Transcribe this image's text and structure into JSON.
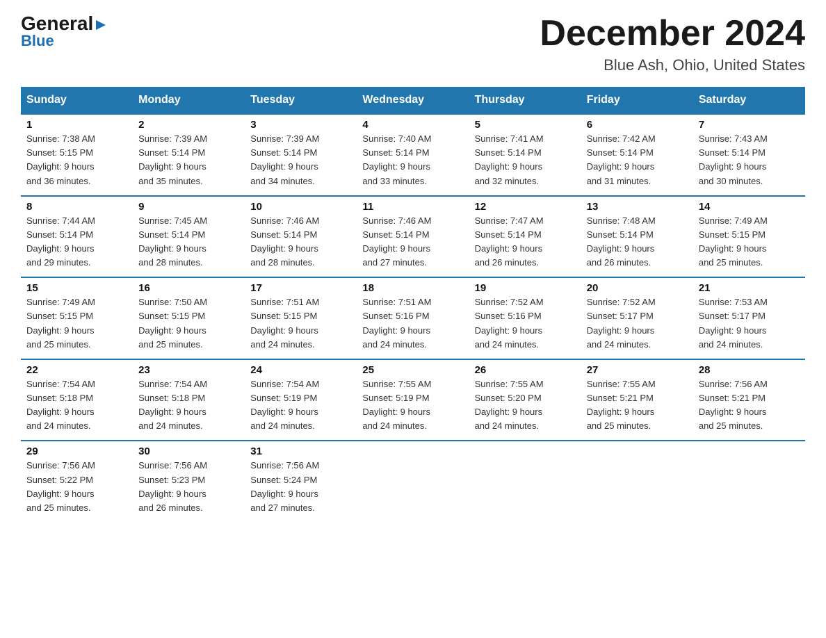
{
  "logo": {
    "general": "General",
    "arrow": "▶",
    "blue": "Blue"
  },
  "title": "December 2024",
  "location": "Blue Ash, Ohio, United States",
  "days_of_week": [
    "Sunday",
    "Monday",
    "Tuesday",
    "Wednesday",
    "Thursday",
    "Friday",
    "Saturday"
  ],
  "weeks": [
    [
      {
        "day": "1",
        "sunrise": "7:38 AM",
        "sunset": "5:15 PM",
        "daylight": "9 hours and 36 minutes."
      },
      {
        "day": "2",
        "sunrise": "7:39 AM",
        "sunset": "5:14 PM",
        "daylight": "9 hours and 35 minutes."
      },
      {
        "day": "3",
        "sunrise": "7:39 AM",
        "sunset": "5:14 PM",
        "daylight": "9 hours and 34 minutes."
      },
      {
        "day": "4",
        "sunrise": "7:40 AM",
        "sunset": "5:14 PM",
        "daylight": "9 hours and 33 minutes."
      },
      {
        "day": "5",
        "sunrise": "7:41 AM",
        "sunset": "5:14 PM",
        "daylight": "9 hours and 32 minutes."
      },
      {
        "day": "6",
        "sunrise": "7:42 AM",
        "sunset": "5:14 PM",
        "daylight": "9 hours and 31 minutes."
      },
      {
        "day": "7",
        "sunrise": "7:43 AM",
        "sunset": "5:14 PM",
        "daylight": "9 hours and 30 minutes."
      }
    ],
    [
      {
        "day": "8",
        "sunrise": "7:44 AM",
        "sunset": "5:14 PM",
        "daylight": "9 hours and 29 minutes."
      },
      {
        "day": "9",
        "sunrise": "7:45 AM",
        "sunset": "5:14 PM",
        "daylight": "9 hours and 28 minutes."
      },
      {
        "day": "10",
        "sunrise": "7:46 AM",
        "sunset": "5:14 PM",
        "daylight": "9 hours and 28 minutes."
      },
      {
        "day": "11",
        "sunrise": "7:46 AM",
        "sunset": "5:14 PM",
        "daylight": "9 hours and 27 minutes."
      },
      {
        "day": "12",
        "sunrise": "7:47 AM",
        "sunset": "5:14 PM",
        "daylight": "9 hours and 26 minutes."
      },
      {
        "day": "13",
        "sunrise": "7:48 AM",
        "sunset": "5:14 PM",
        "daylight": "9 hours and 26 minutes."
      },
      {
        "day": "14",
        "sunrise": "7:49 AM",
        "sunset": "5:15 PM",
        "daylight": "9 hours and 25 minutes."
      }
    ],
    [
      {
        "day": "15",
        "sunrise": "7:49 AM",
        "sunset": "5:15 PM",
        "daylight": "9 hours and 25 minutes."
      },
      {
        "day": "16",
        "sunrise": "7:50 AM",
        "sunset": "5:15 PM",
        "daylight": "9 hours and 25 minutes."
      },
      {
        "day": "17",
        "sunrise": "7:51 AM",
        "sunset": "5:15 PM",
        "daylight": "9 hours and 24 minutes."
      },
      {
        "day": "18",
        "sunrise": "7:51 AM",
        "sunset": "5:16 PM",
        "daylight": "9 hours and 24 minutes."
      },
      {
        "day": "19",
        "sunrise": "7:52 AM",
        "sunset": "5:16 PM",
        "daylight": "9 hours and 24 minutes."
      },
      {
        "day": "20",
        "sunrise": "7:52 AM",
        "sunset": "5:17 PM",
        "daylight": "9 hours and 24 minutes."
      },
      {
        "day": "21",
        "sunrise": "7:53 AM",
        "sunset": "5:17 PM",
        "daylight": "9 hours and 24 minutes."
      }
    ],
    [
      {
        "day": "22",
        "sunrise": "7:54 AM",
        "sunset": "5:18 PM",
        "daylight": "9 hours and 24 minutes."
      },
      {
        "day": "23",
        "sunrise": "7:54 AM",
        "sunset": "5:18 PM",
        "daylight": "9 hours and 24 minutes."
      },
      {
        "day": "24",
        "sunrise": "7:54 AM",
        "sunset": "5:19 PM",
        "daylight": "9 hours and 24 minutes."
      },
      {
        "day": "25",
        "sunrise": "7:55 AM",
        "sunset": "5:19 PM",
        "daylight": "9 hours and 24 minutes."
      },
      {
        "day": "26",
        "sunrise": "7:55 AM",
        "sunset": "5:20 PM",
        "daylight": "9 hours and 24 minutes."
      },
      {
        "day": "27",
        "sunrise": "7:55 AM",
        "sunset": "5:21 PM",
        "daylight": "9 hours and 25 minutes."
      },
      {
        "day": "28",
        "sunrise": "7:56 AM",
        "sunset": "5:21 PM",
        "daylight": "9 hours and 25 minutes."
      }
    ],
    [
      {
        "day": "29",
        "sunrise": "7:56 AM",
        "sunset": "5:22 PM",
        "daylight": "9 hours and 25 minutes."
      },
      {
        "day": "30",
        "sunrise": "7:56 AM",
        "sunset": "5:23 PM",
        "daylight": "9 hours and 26 minutes."
      },
      {
        "day": "31",
        "sunrise": "7:56 AM",
        "sunset": "5:24 PM",
        "daylight": "9 hours and 27 minutes."
      },
      null,
      null,
      null,
      null
    ]
  ]
}
